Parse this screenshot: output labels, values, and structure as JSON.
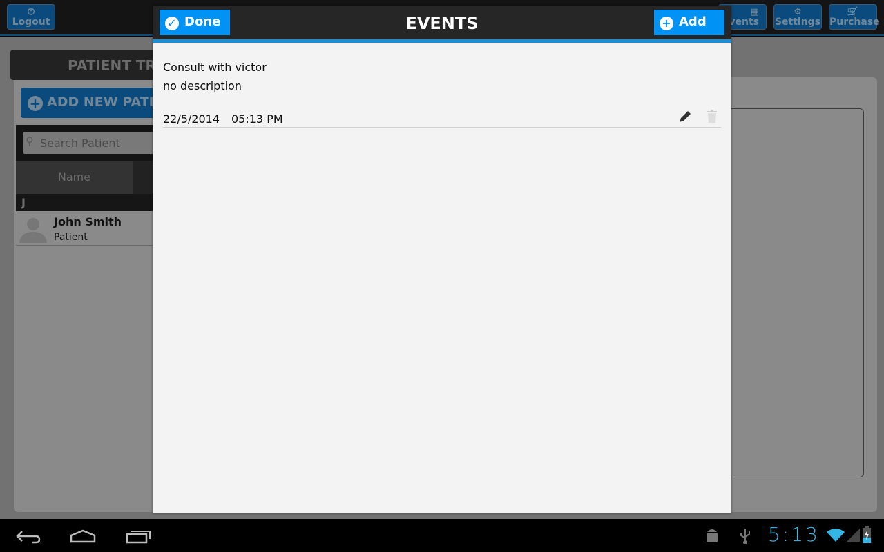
{
  "topbar": {
    "logout": "Logout",
    "events": "Events",
    "settings": "Settings",
    "purchase": "Purchase"
  },
  "background": {
    "title": "PATIENT TRACKER",
    "add_patient": "ADD NEW PATIENT",
    "search_placeholder": "Search Patient",
    "column_name": "Name",
    "section_letter": "J",
    "patients": [
      {
        "name": "John Smith",
        "role": "Patient"
      }
    ]
  },
  "modal": {
    "title": "EVENTS",
    "done": "Done",
    "add": "Add",
    "events": [
      {
        "title": "Consult with victor",
        "description": "no description",
        "date": "22/5/2014",
        "time": "05:13 PM"
      }
    ]
  },
  "statusbar": {
    "time": "5:13"
  },
  "colors": {
    "accent": "#0093f5",
    "clock": "#33b5e5"
  }
}
